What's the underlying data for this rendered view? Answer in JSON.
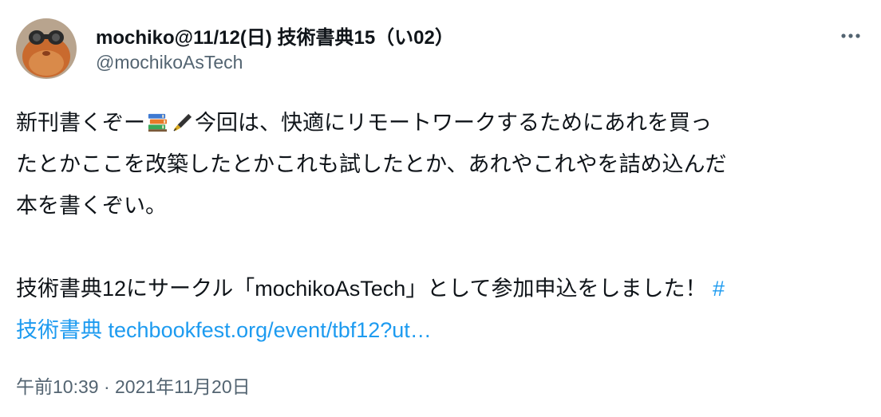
{
  "author": {
    "display_name": "mochiko@11/12(日) 技術書典15（い02）",
    "handle": "@mochikoAsTech"
  },
  "icons": {
    "more": "more-horizontal-icon",
    "books_emoji": "books-emoji-icon",
    "pen_emoji": "fountain-pen-emoji-icon"
  },
  "tweet": {
    "line1_text": "新刊書くぞー",
    "line1_rest": "今回は、快適にリモートワークするためにあれを買っ",
    "line2": "たとかここを改築したとかこれも試したとか、あれやこれやを詰め込んだ",
    "line3": "本を書くぞい。",
    "line4_text": "技術書典12にサークル「mochikoAsTech」として参加申込をしました！",
    "hashtag_part1": "#",
    "hashtag_part2": "技術書典",
    "link": "techbookfest.org/event/tbf12?ut…"
  },
  "meta": {
    "time": "午前10:39",
    "separator": "·",
    "date": "2021年11月20日"
  },
  "colors": {
    "text": "#0f1419",
    "secondary": "#536471",
    "link": "#1d9bf0"
  }
}
